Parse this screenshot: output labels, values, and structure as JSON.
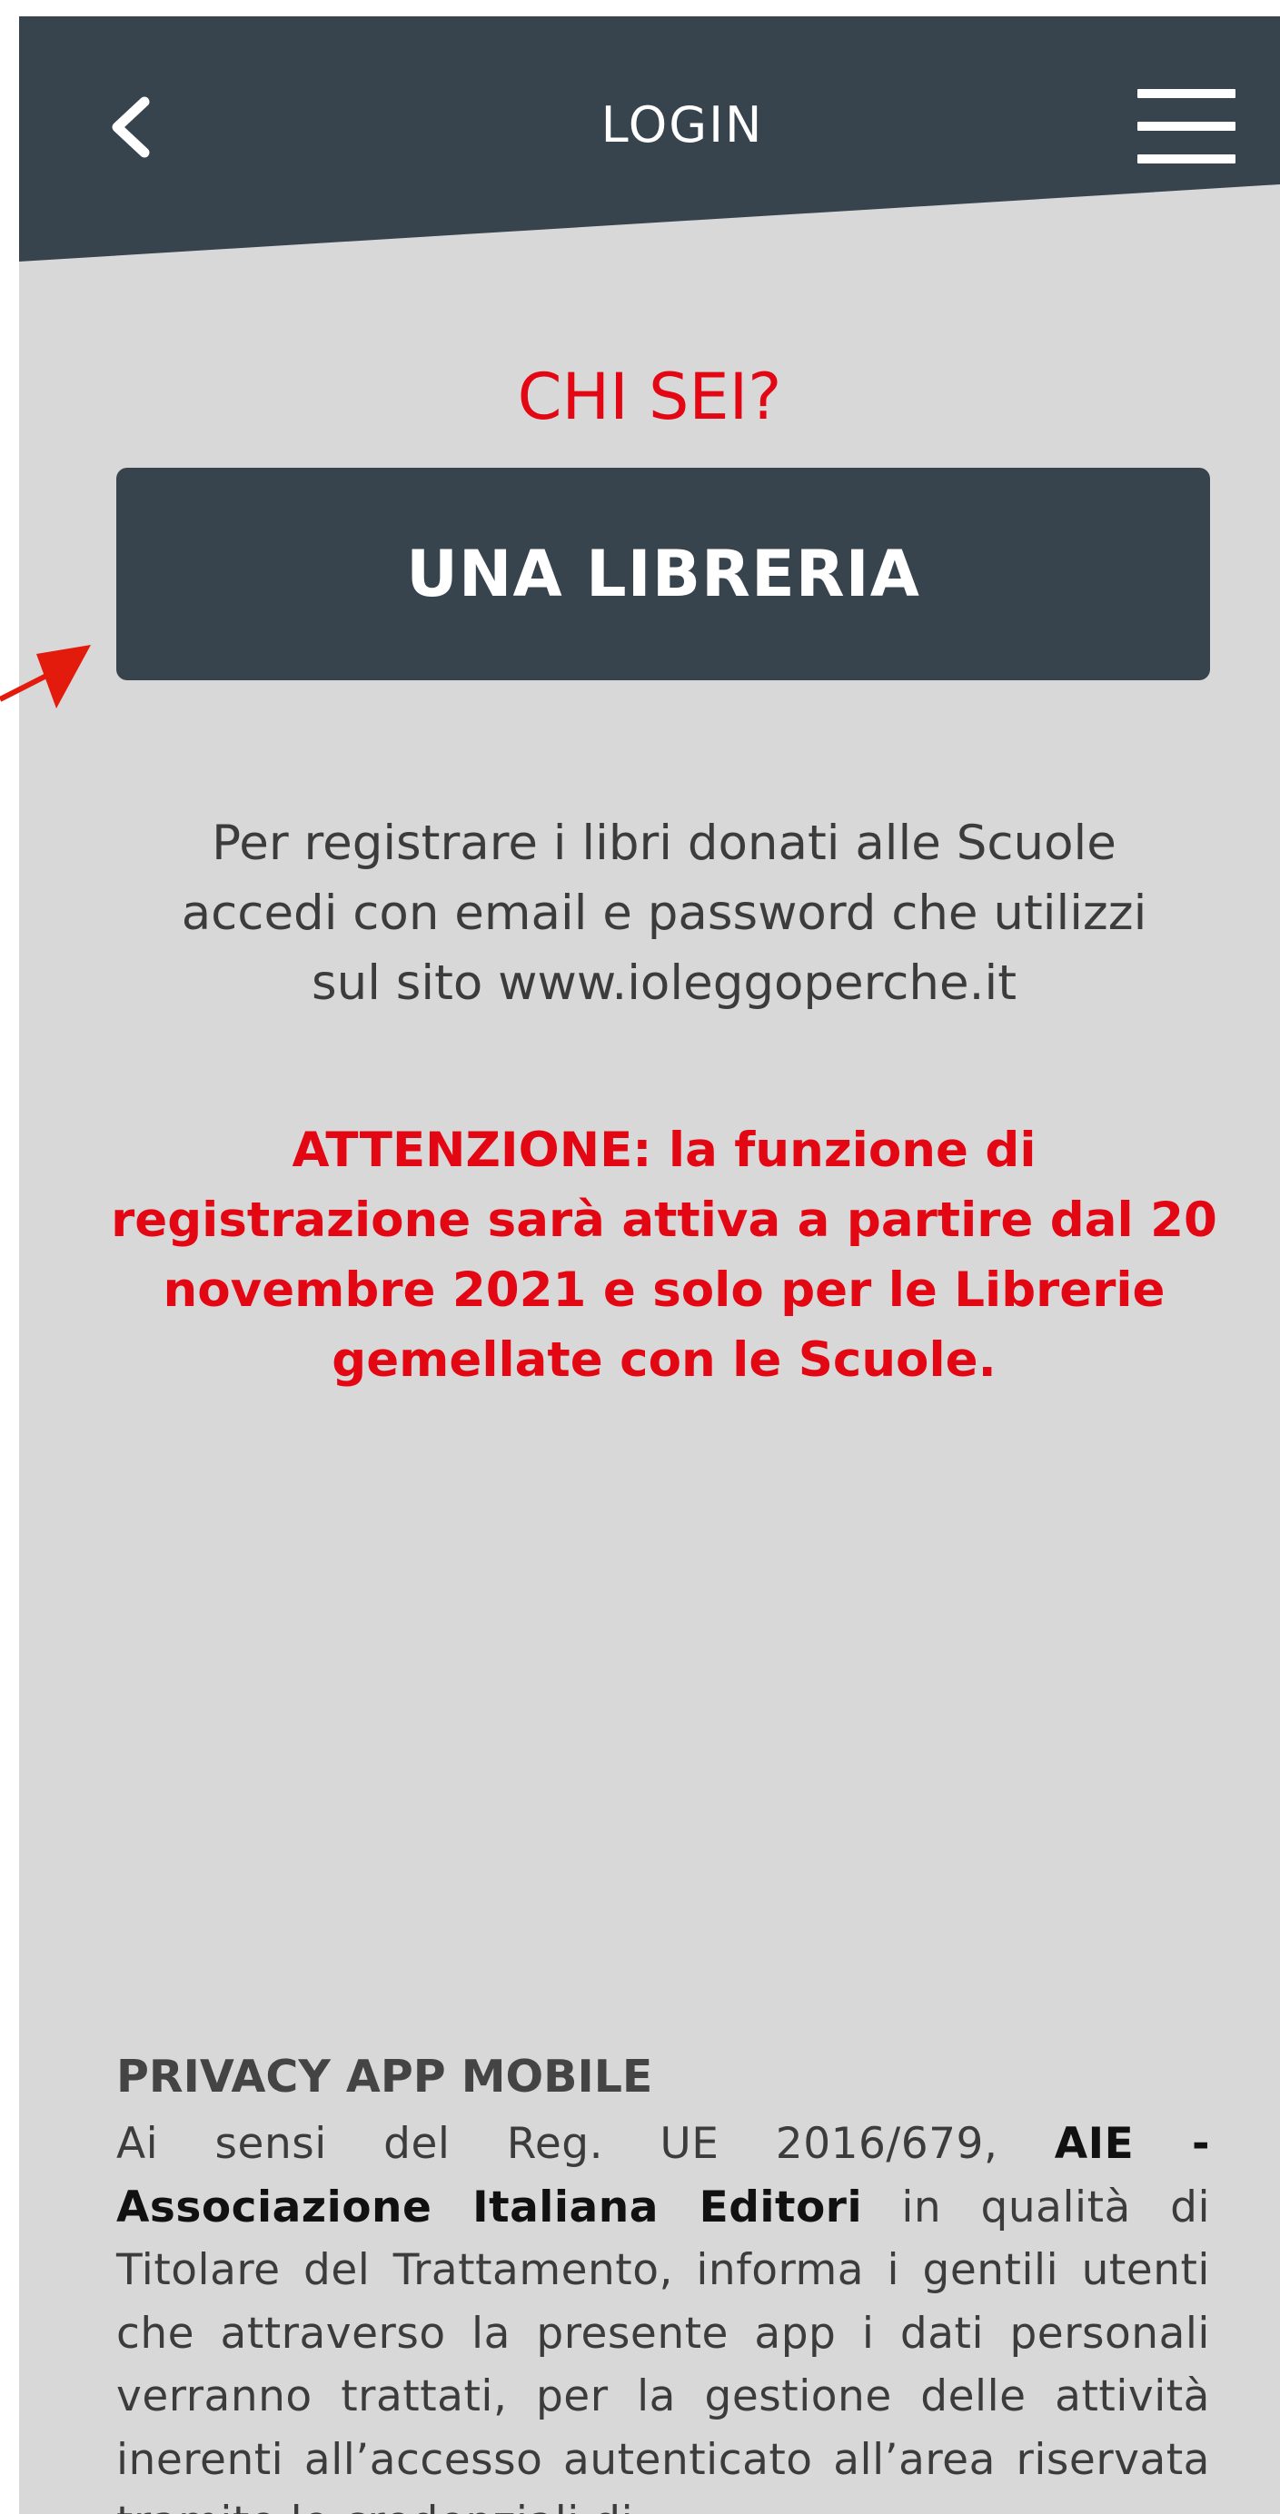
{
  "header": {
    "title": "LOGIN",
    "back_icon": "chevron-left-icon",
    "menu_icon": "hamburger-menu-icon"
  },
  "content": {
    "heading": "CHI SEI?",
    "library_button_label": "UNA LIBRERIA",
    "info_lines": [
      "Per registrare i libri donati alle Scuole",
      "accedi con email e password che utilizzi",
      "sul sito www.ioleggoperche.it"
    ],
    "warning_lines": [
      "ATTENZIONE: la funzione di",
      "registrazione sarà attiva a partire dal 20",
      "novembre 2021 e solo per le Librerie",
      "gemellate con le Scuole."
    ]
  },
  "privacy": {
    "title": "PRIVACY APP MOBILE",
    "intro": "Ai sensi del Reg. UE 2016/679, ",
    "org_name": "AIE - Associazione Italiana Editori",
    "body": " in qualità di Titolare del Trattamento, informa i gentili utenti che attraverso la presente app i dati personali verranno trattati, per la gestione delle attività inerenti all’accesso autenticato all’area riservata tramite le credenziali di"
  },
  "colors": {
    "header_bg": "#37444e",
    "page_bg": "#d8d8d8",
    "accent_red": "#e30613",
    "button_bg": "#37444e"
  }
}
